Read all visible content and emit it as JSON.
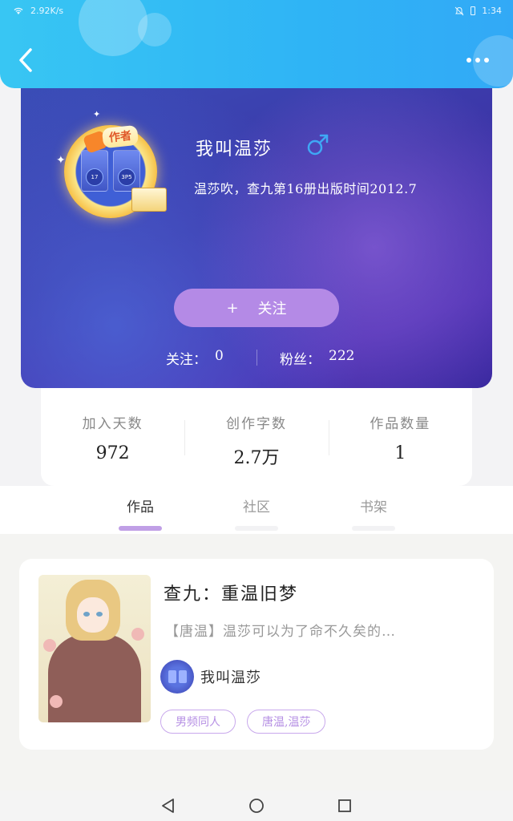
{
  "status_bar": {
    "speed": "2.92K/s",
    "time": "1:34"
  },
  "profile": {
    "username": "我叫温莎",
    "gender_icon": "male-symbol-icon",
    "bio": "温莎吹，查九第16册出版时间2012.7",
    "author_badge": "作者",
    "follow_button": {
      "icon": "+",
      "label": "关注"
    },
    "following_label": "关注：",
    "following_count": "0",
    "followers_label": "粉丝：",
    "followers_count": "222"
  },
  "stats": [
    {
      "label": "加入天数",
      "value": "972"
    },
    {
      "label": "创作字数",
      "value": "2.7万"
    },
    {
      "label": "作品数量",
      "value": "1"
    }
  ],
  "tabs": [
    {
      "label": "作品",
      "active": true
    },
    {
      "label": "社区",
      "active": false
    },
    {
      "label": "书架",
      "active": false
    }
  ],
  "work": {
    "title": "查九：重温旧梦",
    "description": "【唐温】温莎可以为了命不久矣的…",
    "author_name": "我叫温莎",
    "tags": [
      "男频同人",
      "唐温,温莎"
    ]
  },
  "colors": {
    "header": "#2fb4f5",
    "profile_bg": "#3c36a8",
    "accent_purple": "#b48ae6",
    "tag_purple": "#c8a8ec"
  }
}
